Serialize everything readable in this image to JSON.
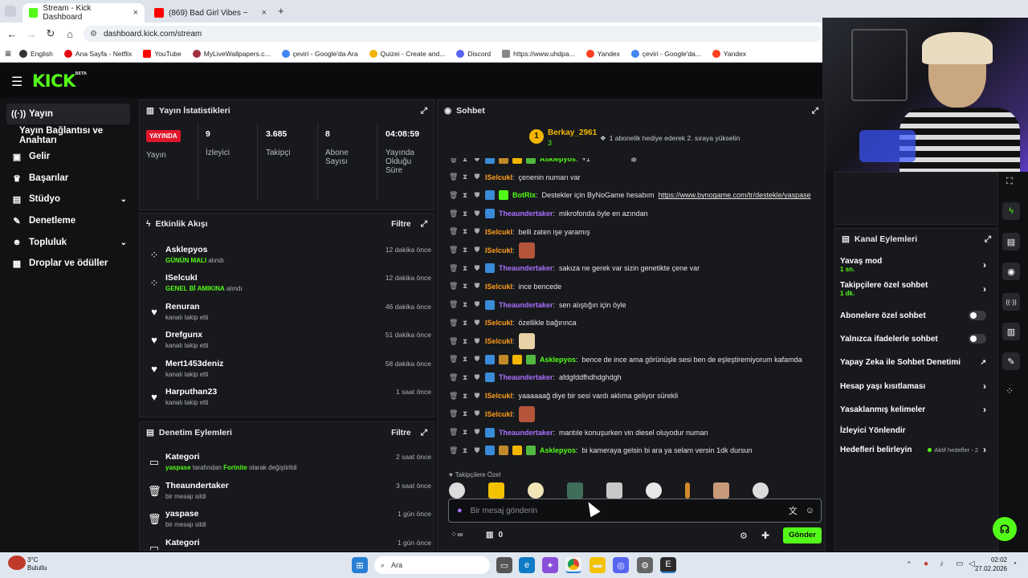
{
  "browser": {
    "tabs": [
      {
        "title": "Stream - Kick Dashboard"
      },
      {
        "title": "(869) Bad Girl Vibes ~ 2000"
      }
    ],
    "url": "dashboard.kick.com/stream",
    "bookmarks": [
      "English",
      "Ana Sayfa - Netflix",
      "YouTube",
      "MyLiveWallpapers.c...",
      "çeviri - Google'da Ara",
      "Quizei - Create and...",
      "Discord",
      "https://www.uhdpa...",
      "Yandex",
      "çeviri - Google'da...",
      "Yandex"
    ]
  },
  "brand": {
    "logo": "KICK",
    "beta": "BETA"
  },
  "sidebar": {
    "items": [
      {
        "label": "Yayın",
        "icon": "broadcast-icon"
      },
      {
        "label": "Yayın Bağlantısı ve Anahtarı"
      },
      {
        "label": "Gelir",
        "icon": "wallet-icon"
      },
      {
        "label": "Başarılar",
        "icon": "trophy-icon"
      },
      {
        "label": "Stüdyo",
        "icon": "studio-icon"
      },
      {
        "label": "Denetleme",
        "icon": "wrench-icon"
      },
      {
        "label": "Topluluk",
        "icon": "community-icon"
      },
      {
        "label": "Droplar ve ödüller",
        "icon": "gift-icon"
      }
    ]
  },
  "stats": {
    "title": "Yayın İstatistikleri",
    "live_badge": "YAYINDA",
    "live_label": "Yayın",
    "viewers": {
      "value": "9",
      "label": "İzleyici"
    },
    "followers": {
      "value": "3.685",
      "label": "Takipçi"
    },
    "subs": {
      "value": "8",
      "label": "Abone Sayısı"
    },
    "duration": {
      "value": "04:08:59",
      "label": "Yayında Olduğu Süre"
    }
  },
  "activity": {
    "title": "Etkinlik Akışı",
    "filter": "Filtre",
    "items": [
      {
        "name": "Asklepyos",
        "highlight": "GÜNÜN MALI",
        "action": "alındı",
        "time": "12 dakika önce"
      },
      {
        "name": "ISelcukI",
        "highlight": "GENEL Bİ AMIKINA",
        "action": "alındı",
        "time": "12 dakika önce"
      },
      {
        "name": "Renuran",
        "highlight": "",
        "action": "kanalı takip etti",
        "time": "46 dakika önce"
      },
      {
        "name": "Drefgunx",
        "highlight": "",
        "action": "kanalı takip etti",
        "time": "51 dakika önce"
      },
      {
        "name": "Mert1453deniz",
        "highlight": "",
        "action": "kanalı takip etti",
        "time": "58 dakika önce"
      },
      {
        "name": "Harputhan23",
        "highlight": "",
        "action": "kanalı takip etti",
        "time": "1 saat önce"
      }
    ]
  },
  "moderation": {
    "title": "Denetim Eylemleri",
    "filter": "Filtre",
    "items": [
      {
        "name": "Kategori",
        "detail_user": "yaspase",
        "detail_mid": "tarafından",
        "detail_game": "Fortnite",
        "detail_end": "olarak değiştirildi",
        "time": "2 saat önce"
      },
      {
        "name": "Theaundertaker",
        "detail": "bir mesajı sildi",
        "time": "3 saat önce"
      },
      {
        "name": "yaspase",
        "detail": "bir mesajı sildi",
        "time": "1 gün önce"
      },
      {
        "name": "Kategori",
        "detail": "",
        "time": "1 gün önce"
      }
    ]
  },
  "chat": {
    "title": "Sohbet",
    "top_gifter": {
      "rank": "1",
      "name": "Berkay_2961",
      "count": "3"
    },
    "notice": "1 abonelik hediye ederek 2. sıraya yükselin",
    "messages": [
      {
        "user": "Asklepyos",
        "color": "#53fc18",
        "text": "+1"
      },
      {
        "user": "ISelcukI",
        "color": "#ff9d1c",
        "text": "çenenin numarı var"
      },
      {
        "user": "BotRix",
        "color": "#53fc18",
        "text": "Destekler için ByNoGame hesabım",
        "link": "https://www.bynogame.com/tr/destekle/yaspase"
      },
      {
        "user": "Theaundertaker",
        "color": "#a970ff",
        "text": "mikrofonda öyle en azından"
      },
      {
        "user": "ISelcukI",
        "color": "#ff9d1c",
        "text": "belli zaten işe yaramış"
      },
      {
        "user": "ISelcukI",
        "color": "#ff9d1c",
        "text": "",
        "emote": "#b5553c"
      },
      {
        "user": "Theaundertaker",
        "color": "#a970ff",
        "text": "sakıza ne gerek var sizin genetikte çene var"
      },
      {
        "user": "ISelcukI",
        "color": "#ff9d1c",
        "text": "ince bencede"
      },
      {
        "user": "Theaundertaker",
        "color": "#a970ff",
        "text": "sen alıştığın için öyle"
      },
      {
        "user": "ISelcukI",
        "color": "#ff9d1c",
        "text": "özellikle bağırınca"
      },
      {
        "user": "ISelcukI",
        "color": "#ff9d1c",
        "text": "",
        "emote": "#e8d2a6"
      },
      {
        "user": "Asklepyos",
        "color": "#53fc18",
        "text": "bence de ince ama görünüşle sesi ben de eşleştiremiyorum kafamda"
      },
      {
        "user": "Theaundertaker",
        "color": "#a970ff",
        "text": "afdgfddfhdhdghdgh"
      },
      {
        "user": "ISelcukI",
        "color": "#ff9d1c",
        "text": "yaaaaaağ diye bir sesi vardı aklıma geliyor sürekli"
      },
      {
        "user": "ISelcukI",
        "color": "#ff9d1c",
        "text": "",
        "emote": "#b5553c"
      },
      {
        "user": "Theaundertaker",
        "color": "#a970ff",
        "text": "mantıle konuşurken vin diesel oluyodur numan"
      },
      {
        "user": "Asklepyos",
        "color": "#53fc18",
        "text": "bi kameraya gelsin bi ara ya selam versin 1dk dursun"
      }
    ],
    "followers_only": "Takipçilere Özel",
    "placeholder": "Bir mesaj gönderin",
    "points": "0",
    "send": "Gönder"
  },
  "channel_actions": {
    "title": "Kanal Eylemleri",
    "items": [
      {
        "label": "Yavaş mod",
        "sub": "1 sn.",
        "kind": "chevron"
      },
      {
        "label": "Takipçilere özel sohbet",
        "sub": "1 dk.",
        "kind": "chevron"
      },
      {
        "label": "Abonelere özel sohbet",
        "sub": "",
        "kind": "toggle"
      },
      {
        "label": "Yalnızca ifadelerle sohbet",
        "sub": "",
        "kind": "toggle"
      },
      {
        "label": "Yapay Zeka ile Sohbet Denetimi",
        "sub": "",
        "kind": "external"
      },
      {
        "label": "Hesap yaşı kısıtlaması",
        "sub": "",
        "kind": "chevron"
      },
      {
        "label": "Yasaklanmış kelimeler",
        "sub": "",
        "kind": "chevron"
      },
      {
        "label": "İzleyici Yönlendir",
        "sub": "",
        "kind": "none"
      },
      {
        "label": "Hedefleri belirleyin",
        "sub": "",
        "kind": "chevron",
        "status": "Aktif hedefler - 2"
      }
    ]
  },
  "taskbar": {
    "weather_temp": "3°C",
    "weather_desc": "Bulutlu",
    "search": "Ara",
    "time": "02:02",
    "date": "27.02.2026"
  }
}
